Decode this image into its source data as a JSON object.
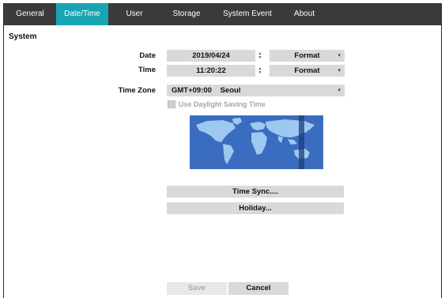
{
  "tabs": [
    {
      "label": "General"
    },
    {
      "label": "Date/Time"
    },
    {
      "label": "User"
    },
    {
      "label": "Storage"
    },
    {
      "label": "System Event"
    },
    {
      "label": "About"
    }
  ],
  "active_tab": "Date/Time",
  "section": {
    "title": "System"
  },
  "date": {
    "label": "Date",
    "value": "2019/04/24",
    "format_label": "Format"
  },
  "time": {
    "label": "Time",
    "value": "11:20:22",
    "format_label": "Format"
  },
  "time_zone": {
    "label": "Time Zone",
    "offset": "GMT+09:00",
    "city": "Seoul"
  },
  "dst": {
    "label": "Use Daylight Saving Time",
    "checked": false,
    "enabled": false
  },
  "buttons": {
    "time_sync": "Time Sync....",
    "holiday": "Holiday...",
    "save": "Save",
    "cancel": "Cancel"
  },
  "colors": {
    "tab_bar": "#3a3a3a",
    "active_tab": "#17a5b4",
    "field": "#d9d9d9",
    "map_ocean": "#3a6cc0",
    "map_land": "#9fc8f0"
  },
  "icons": {
    "spinner": "up-down-arrows",
    "dropdown": "chevron-down"
  }
}
